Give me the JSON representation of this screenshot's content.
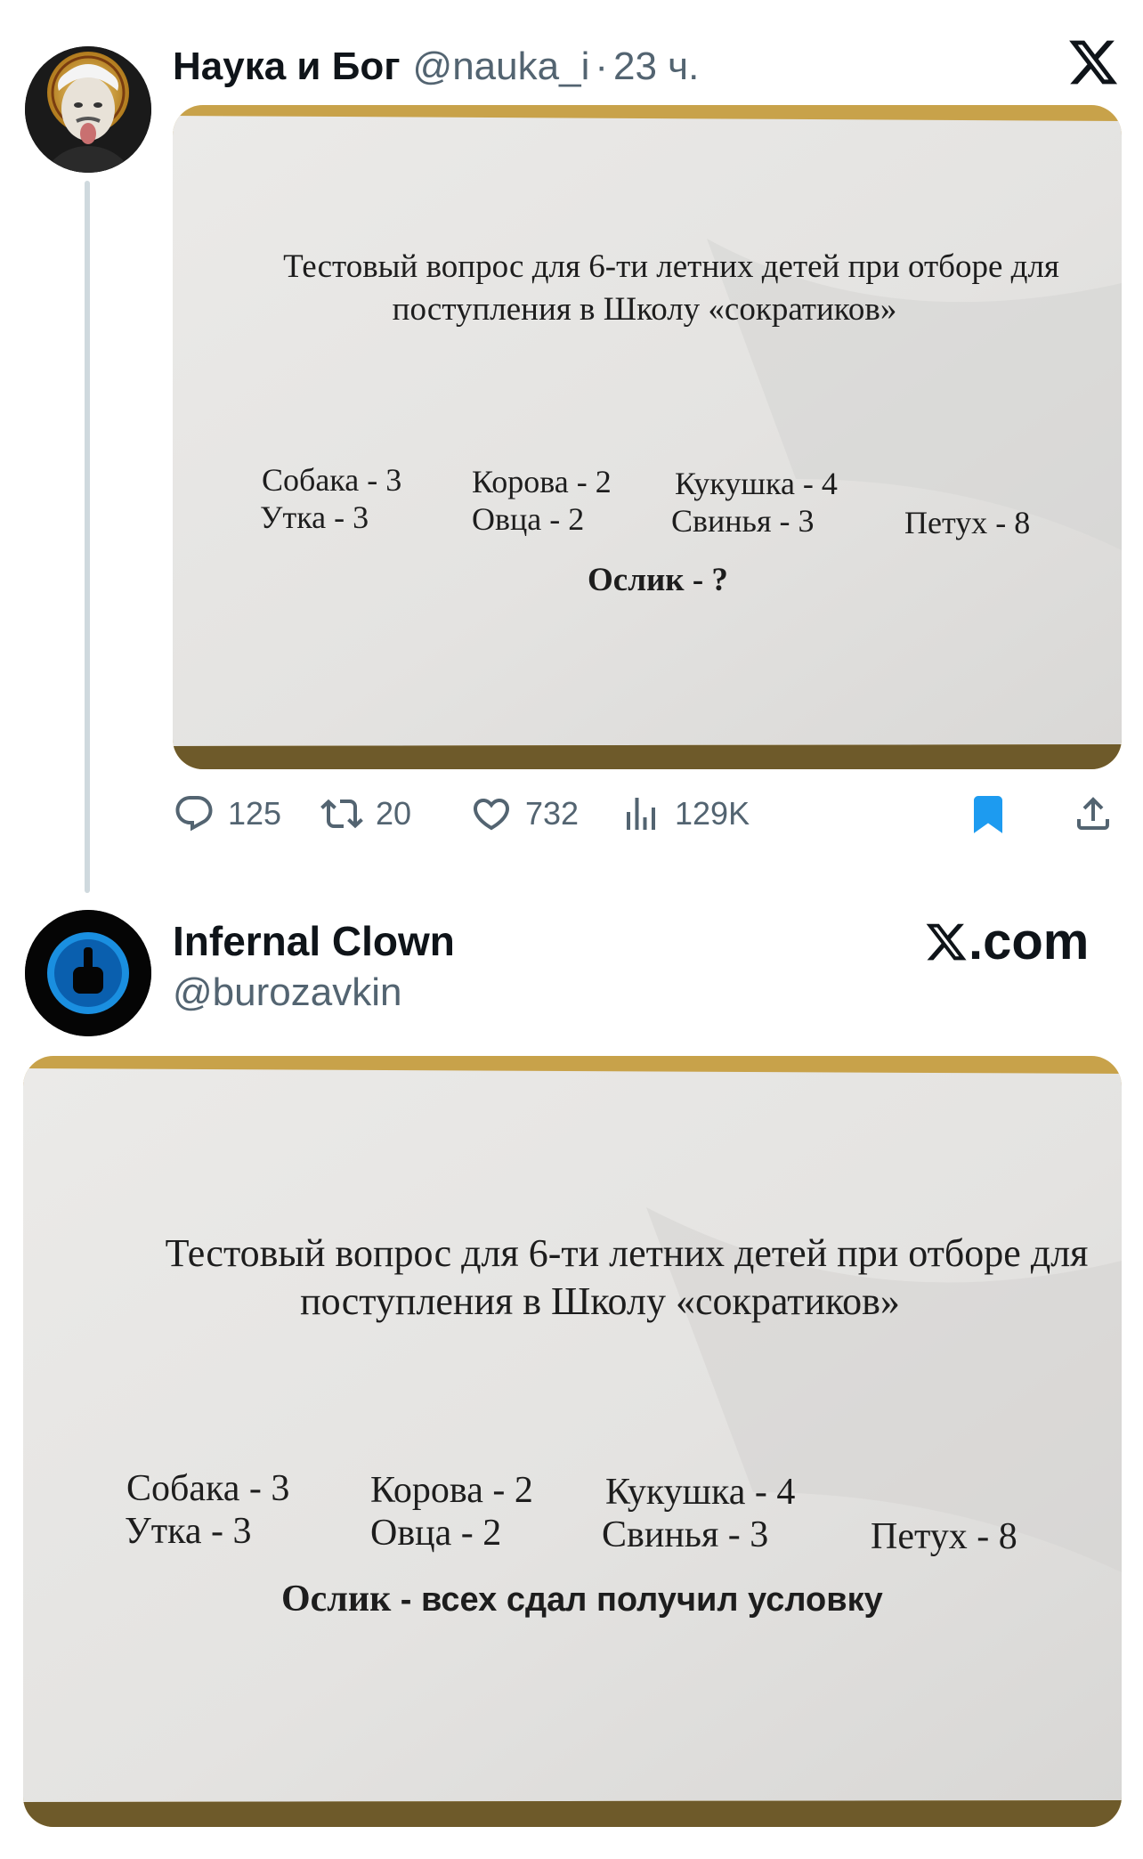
{
  "tweet1": {
    "author_name": "Наука и Бог",
    "handle": "@nauka_i",
    "separator": "·",
    "time": "23 ч.",
    "photo": {
      "title_line1": "Тестовый вопрос для 6-ти летних детей при отборе для",
      "title_line2": "поступления в Школу «сократиков»",
      "items_row1": [
        "Собака - 3",
        "Корова - 2",
        "Кукушка - 4"
      ],
      "items_row2": [
        "Утка - 3",
        "Овца - 2",
        "Свинья - 3",
        "Петух - 8"
      ],
      "question_word": "Ослик",
      "question_value": "- ?"
    },
    "actions": {
      "replies": "125",
      "reposts": "20",
      "likes": "732",
      "views": "129K"
    }
  },
  "tweet2": {
    "author_name": "Infernal Clown",
    "handle": "@burozavkin",
    "brand": ".com",
    "photo": {
      "title_line1": "Тестовый вопрос для 6-ти летних детей при отборе для",
      "title_line2": "поступления в Школу «сократиков»",
      "items_row1": [
        "Собака - 3",
        "Корова - 2",
        "Кукушка - 4"
      ],
      "items_row2": [
        "Утка - 3",
        "Овца - 2",
        "Свинья - 3",
        "Петух - 8"
      ],
      "question_word": "Ослик",
      "question_value": "- всех сдал получил условку"
    }
  },
  "colors": {
    "text": "#0f1419",
    "secondary": "#536471",
    "bookmark": "#1d9bf0",
    "thread_line": "#cfd9de",
    "paper": "#e9e8e6",
    "wood": "#c9a44c"
  },
  "icons": [
    "x-logo-icon",
    "reply-icon",
    "repost-icon",
    "like-icon",
    "views-icon",
    "bookmark-icon",
    "share-icon"
  ]
}
